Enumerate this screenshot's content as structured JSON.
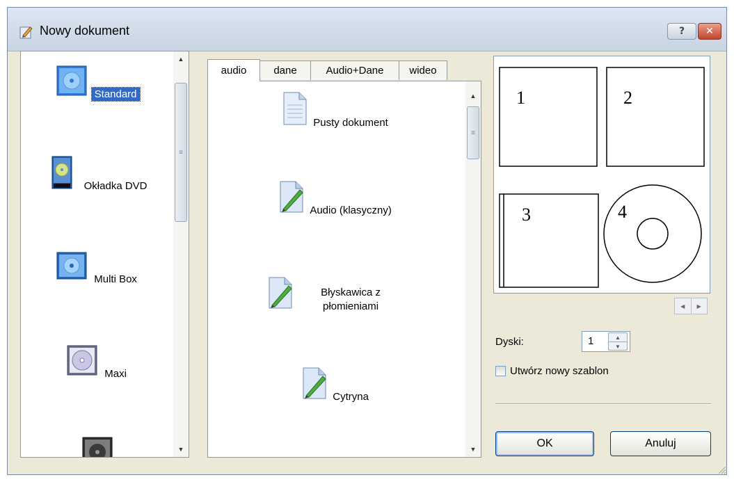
{
  "window": {
    "title": "Nowy dokument",
    "help_label": "?",
    "close_label": "✕"
  },
  "templates": {
    "items": [
      {
        "label": "Standard",
        "icon": "cd-box-blue-icon",
        "selected": true
      },
      {
        "label": "Okładka DVD",
        "icon": "dvd-case-icon",
        "selected": false
      },
      {
        "label": "Multi Box",
        "icon": "multi-box-icon",
        "selected": false
      },
      {
        "label": "Maxi",
        "icon": "maxi-disc-icon",
        "selected": false
      },
      {
        "label": "",
        "icon": "dark-box-icon",
        "selected": false
      }
    ]
  },
  "tabs": [
    {
      "label": "audio",
      "active": true
    },
    {
      "label": "dane",
      "active": false
    },
    {
      "label": "Audio+Dane",
      "active": false
    },
    {
      "label": "wideo",
      "active": false
    }
  ],
  "documents": [
    {
      "label": "Pusty dokument",
      "icon": "blank-document-icon"
    },
    {
      "label": "Audio (klasyczny)",
      "icon": "document-pen-icon"
    },
    {
      "label": "Błyskawica z płomieniami",
      "icon": "document-pen-icon"
    },
    {
      "label": "Cytryna",
      "icon": "document-pen-icon"
    }
  ],
  "preview": {
    "labels": [
      "1",
      "2",
      "3",
      "4"
    ]
  },
  "disks": {
    "label": "Dyski:",
    "value": "1"
  },
  "new_template": {
    "label": "Utwórz nowy szablon",
    "checked": false
  },
  "buttons": {
    "ok": "OK",
    "cancel": "Anuluj"
  },
  "colors": {
    "selection": "#316ac5",
    "dialog_bg": "#ece9d8"
  }
}
